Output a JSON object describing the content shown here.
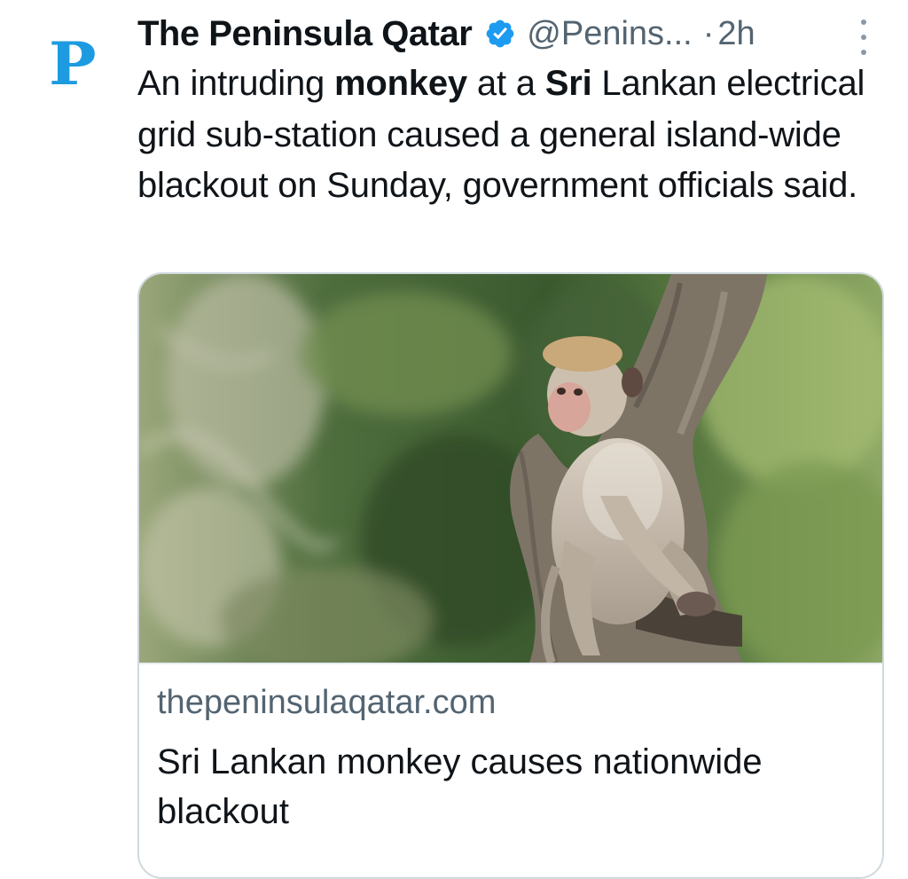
{
  "account": {
    "avatar_letter": "P",
    "name": "The Peninsula Qatar",
    "handle": "@Penins...",
    "separator": "·",
    "time": "2h",
    "verified_icon": "verified-badge-icon",
    "accent_color": "#1d9be1"
  },
  "tweet": {
    "segments": [
      {
        "text": "An intruding ",
        "bold": false
      },
      {
        "text": "monkey",
        "bold": true
      },
      {
        "text": " at a ",
        "bold": false
      },
      {
        "text": "Sri",
        "bold": true
      },
      {
        "text": " Lankan electrical grid sub-station caused a general island-wide blackout on Sunday, government officials said.",
        "bold": false
      }
    ]
  },
  "card": {
    "image_icon": "monkey-photo",
    "domain": "thepeninsulaqatar.com",
    "title": "Sri Lankan monkey causes nationwide blackout"
  },
  "menu": {
    "icon": "more-options-icon"
  }
}
